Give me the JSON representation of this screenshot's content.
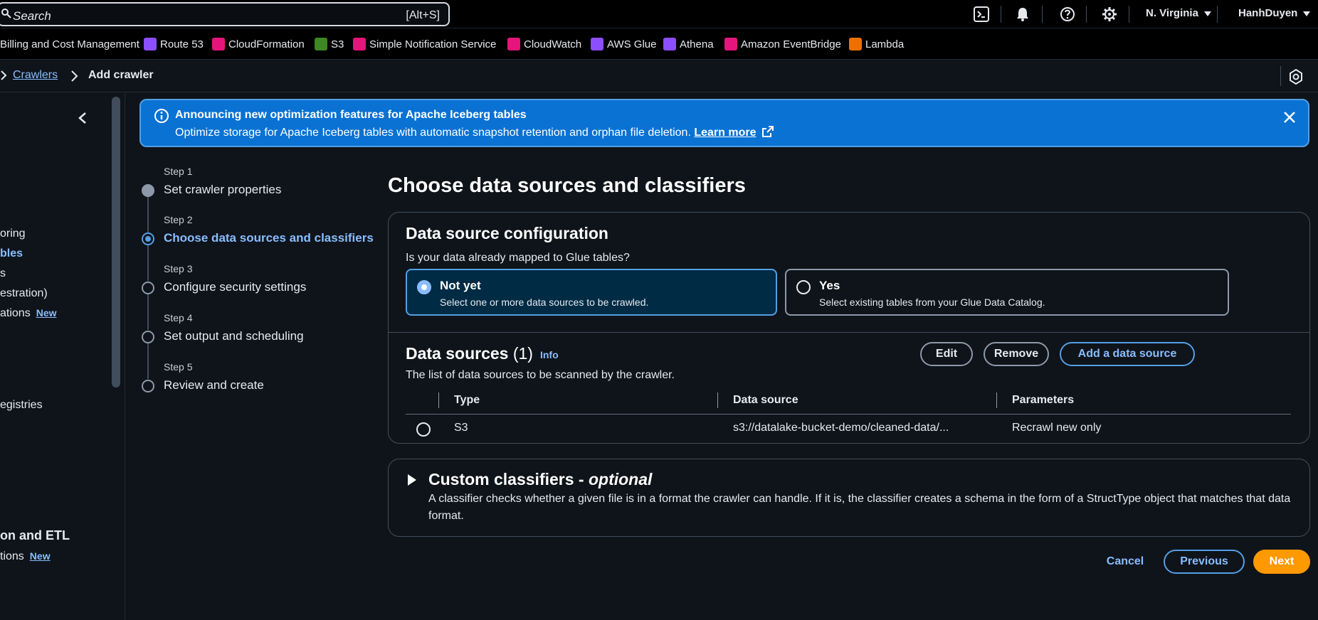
{
  "topbar": {
    "search_placeholder": "Search",
    "search_shortcut": "[Alt+S]",
    "region": "N. Virginia",
    "user": "HanhDuyen"
  },
  "favorites": [
    {
      "label": "Billing and Cost Management",
      "color": ""
    },
    {
      "label": "Route 53",
      "color": "#8c4fff"
    },
    {
      "label": "CloudFormation",
      "color": "#e7157b"
    },
    {
      "label": "S3",
      "color": "#3f8624"
    },
    {
      "label": "Simple Notification Service",
      "color": "#e7157b"
    },
    {
      "label": "CloudWatch",
      "color": "#e7157b"
    },
    {
      "label": "AWS Glue",
      "color": "#8c4fff"
    },
    {
      "label": "Athena",
      "color": "#8c4fff"
    },
    {
      "label": "Amazon EventBridge",
      "color": "#e7157b"
    },
    {
      "label": "Lambda",
      "color": "#ed7100"
    }
  ],
  "breadcrumb": {
    "link": "Crawlers",
    "current": "Add crawler"
  },
  "leftnav": {
    "items": [
      {
        "label": "oring"
      },
      {
        "label": "bles"
      },
      {
        "label": "s"
      },
      {
        "label": "estration)"
      },
      {
        "label": "ations",
        "badge": "New"
      },
      {
        "label": "egistries"
      },
      {
        "label": "tions",
        "badge": "New"
      }
    ],
    "section_heading": "on and ETL"
  },
  "banner": {
    "title": "Announcing new optimization features for Apache Iceberg tables",
    "description": "Optimize storage for Apache Iceberg tables with automatic snapshot retention and orphan file deletion.",
    "link": "Learn more"
  },
  "steps": [
    {
      "label": "Step 1",
      "name": "Set crawler properties"
    },
    {
      "label": "Step 2",
      "name": "Choose data sources and classifiers"
    },
    {
      "label": "Step 3",
      "name": "Configure security settings"
    },
    {
      "label": "Step 4",
      "name": "Set output and scheduling"
    },
    {
      "label": "Step 5",
      "name": "Review and create"
    }
  ],
  "page_title": "Choose data sources and classifiers",
  "config": {
    "heading": "Data source configuration",
    "question": "Is your data already mapped to Glue tables?",
    "options": [
      {
        "title": "Not yet",
        "description": "Select one or more data sources to be crawled."
      },
      {
        "title": "Yes",
        "description": "Select existing tables from your Glue Data Catalog."
      }
    ]
  },
  "sources": {
    "heading": "Data sources",
    "count": "(1)",
    "info": "Info",
    "description": "The list of data sources to be scanned by the crawler.",
    "buttons": {
      "edit": "Edit",
      "remove": "Remove",
      "add": "Add a data source"
    },
    "columns": [
      "Type",
      "Data source",
      "Parameters"
    ],
    "rows": [
      {
        "type": "S3",
        "source": "s3://datalake-bucket-demo/cleaned-data/...",
        "parameters": "Recrawl new only"
      }
    ]
  },
  "classifiers": {
    "title": "Custom classifiers - ",
    "title_optional": "optional",
    "description": "A classifier checks whether a given file is in a format the crawler can handle. If it is, the classifier creates a schema in the form of a StructType object that matches that data format."
  },
  "footer": {
    "cancel": "Cancel",
    "previous": "Previous",
    "next": "Next"
  }
}
